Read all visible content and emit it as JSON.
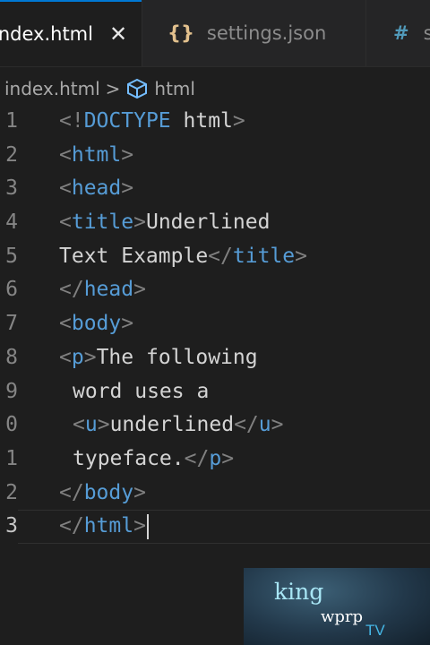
{
  "tabs": [
    {
      "label": "index.html",
      "active": true,
      "close": "✕"
    },
    {
      "label": "settings.json",
      "icon": "json-braces-icon",
      "icon_glyph": "{}"
    },
    {
      "label": "s",
      "icon": "css-hash-icon",
      "icon_glyph": "#"
    }
  ],
  "breadcrumb": {
    "file": "index.html",
    "separator": ">",
    "symbol_icon": "html-element-icon",
    "symbol": "html"
  },
  "editor": {
    "lines": [
      {
        "number": "1",
        "tokens": [
          {
            "t": "<!",
            "c": "br"
          },
          {
            "t": "DOCTYPE",
            "c": "dt"
          },
          {
            "t": " ",
            "c": "tx"
          },
          {
            "t": "html",
            "c": "tx"
          },
          {
            "t": ">",
            "c": "br"
          }
        ]
      },
      {
        "number": "2",
        "tokens": [
          {
            "t": "<",
            "c": "br"
          },
          {
            "t": "html",
            "c": "tg"
          },
          {
            "t": ">",
            "c": "br"
          }
        ]
      },
      {
        "number": "3",
        "tokens": [
          {
            "t": "<",
            "c": "br"
          },
          {
            "t": "head",
            "c": "tg"
          },
          {
            "t": ">",
            "c": "br"
          }
        ]
      },
      {
        "number": "4",
        "tokens": [
          {
            "t": "<",
            "c": "br"
          },
          {
            "t": "title",
            "c": "tg"
          },
          {
            "t": ">",
            "c": "br"
          },
          {
            "t": "Underlined",
            "c": "tx"
          }
        ]
      },
      {
        "number": "5",
        "tokens": [
          {
            "t": "Text Example",
            "c": "tx"
          },
          {
            "t": "</",
            "c": "br"
          },
          {
            "t": "title",
            "c": "tg"
          },
          {
            "t": ">",
            "c": "br"
          }
        ]
      },
      {
        "number": "6",
        "tokens": [
          {
            "t": "</",
            "c": "br"
          },
          {
            "t": "head",
            "c": "tg"
          },
          {
            "t": ">",
            "c": "br"
          }
        ]
      },
      {
        "number": "7",
        "tokens": [
          {
            "t": "<",
            "c": "br"
          },
          {
            "t": "body",
            "c": "tg"
          },
          {
            "t": ">",
            "c": "br"
          }
        ]
      },
      {
        "number": "8",
        "tokens": [
          {
            "t": "<",
            "c": "br"
          },
          {
            "t": "p",
            "c": "tg"
          },
          {
            "t": ">",
            "c": "br"
          },
          {
            "t": "The following",
            "c": "tx"
          }
        ]
      },
      {
        "number": "9",
        "indent": true,
        "tokens": [
          {
            "t": "word uses a",
            "c": "tx"
          }
        ]
      },
      {
        "number": "0",
        "indent": true,
        "tokens": [
          {
            "t": "<",
            "c": "br"
          },
          {
            "t": "u",
            "c": "tg"
          },
          {
            "t": ">",
            "c": "br"
          },
          {
            "t": "underlined",
            "c": "tx"
          },
          {
            "t": "</",
            "c": "br"
          },
          {
            "t": "u",
            "c": "tg"
          },
          {
            "t": ">",
            "c": "br"
          }
        ]
      },
      {
        "number": "1",
        "indent": true,
        "tokens": [
          {
            "t": "typeface.",
            "c": "tx"
          },
          {
            "t": "</",
            "c": "br"
          },
          {
            "t": "p",
            "c": "tg"
          },
          {
            "t": ">",
            "c": "br"
          }
        ]
      },
      {
        "number": "2",
        "tokens": [
          {
            "t": "</",
            "c": "br"
          },
          {
            "t": "body",
            "c": "tg"
          },
          {
            "t": ">",
            "c": "br"
          }
        ]
      },
      {
        "number": "3",
        "current": true,
        "tokens": [
          {
            "t": "</",
            "c": "br"
          },
          {
            "t": "html",
            "c": "tg"
          },
          {
            "t": ">",
            "c": "br"
          }
        ]
      }
    ]
  },
  "watermark": {
    "line1": "king",
    "line2": "wprp",
    "line3": "TV"
  },
  "colors": {
    "editor_bg": "#1e1e1e",
    "tag_blue": "#569cd6",
    "bracket_gray": "#808080",
    "text": "#d4d4d4",
    "active_tab_accent": "#0078d4"
  }
}
